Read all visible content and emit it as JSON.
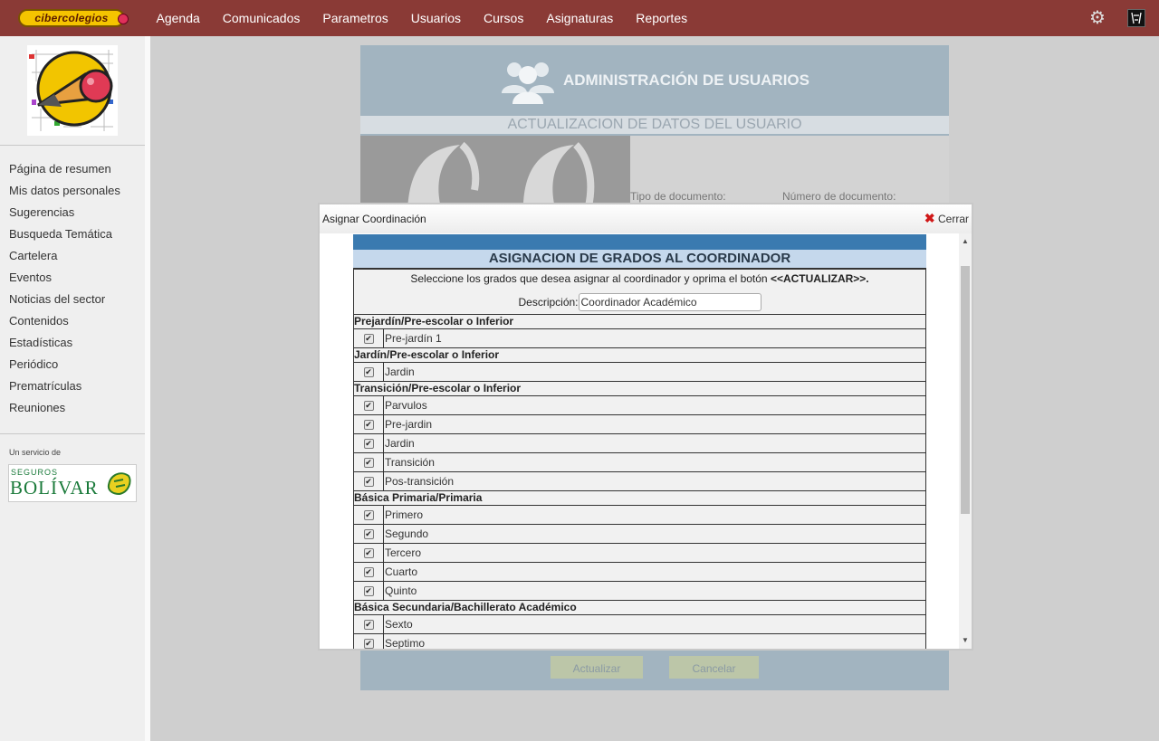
{
  "topbar": {
    "logo_text": "cibercolegios",
    "nav": [
      "Agenda",
      "Comunicados",
      "Parametros",
      "Usuarios",
      "Cursos",
      "Asignaturas",
      "Reportes"
    ]
  },
  "sidebar": {
    "menu": [
      "Página de resumen",
      "Mis datos personales",
      "Sugerencias",
      "Busqueda Temática",
      "Cartelera",
      "Eventos",
      "Noticias del sector",
      "Contenidos",
      "Estadísticas",
      "Periódico",
      "Prematrículas",
      "Reuniones"
    ],
    "service_label": "Un servicio de",
    "sponsor_line1": "SEGUROS",
    "sponsor_line2": "BOLÍVAR"
  },
  "main": {
    "header_title": "ADMINISTRACIÓN DE USUARIOS",
    "update_bar": "ACTUALIZACION DE DATOS DEL USUARIO",
    "doc_type_label": "Tipo de documento:",
    "doc_number_label": "Número de documento:",
    "update_button": "Actualizar",
    "cancel_button": "Cancelar"
  },
  "modal": {
    "title": "Asignar Coordinación",
    "close_label": "Cerrar",
    "form_title": "ASIGNACION DE GRADOS AL COORDINADOR",
    "instruction_prefix": "Seleccione los grados que desea asignar al coordinador y oprima el botón ",
    "instruction_strong": "<<ACTUALIZAR>>.",
    "description_label": "Descripción:",
    "description_value": "Coordinador Académico",
    "groups": [
      {
        "name": "Prejardín/Pre-escolar o Inferior",
        "grades": [
          "Pre-jardín 1"
        ]
      },
      {
        "name": "Jardín/Pre-escolar o Inferior",
        "grades": [
          "Jardin"
        ]
      },
      {
        "name": "Transición/Pre-escolar o Inferior",
        "grades": [
          "Parvulos",
          "Pre-jardin",
          "Jardin",
          "Transición",
          "Pos-transición"
        ]
      },
      {
        "name": "Básica Primaria/Primaria",
        "grades": [
          "Primero",
          "Segundo",
          "Tercero",
          "Cuarto",
          "Quinto"
        ]
      },
      {
        "name": "Básica Secundaria/Bachillerato Académico",
        "grades": [
          "Sexto",
          "Septimo"
        ]
      }
    ],
    "checked_mark": "✔"
  }
}
